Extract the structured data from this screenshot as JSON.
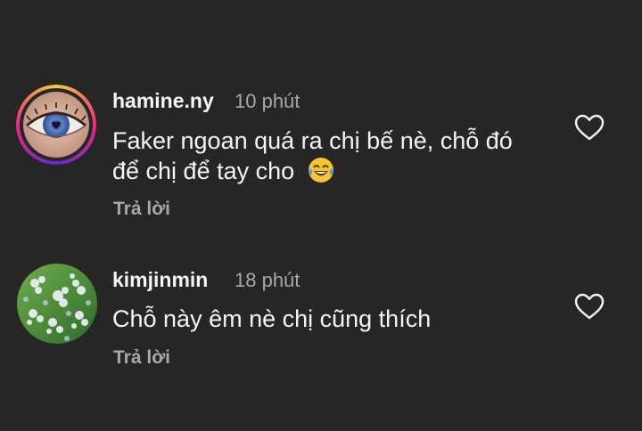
{
  "comments": [
    {
      "username": "hamine.ny",
      "time": "10 phút",
      "line1": "Faker ngoan quá ra chị bế nè, chỗ đó",
      "line2": "để chị để tay cho",
      "emoji": "😂",
      "reply": "Trả lời"
    },
    {
      "username": "kimjinmin",
      "time": "18 phút",
      "line1": "Chỗ này êm nè chị cũng thích",
      "reply": "Trả lời"
    }
  ],
  "colors": {
    "background": "#262626",
    "primary_text": "#f5f5f5",
    "secondary_text": "#a8a8a8"
  },
  "icons": [
    "heart-outline-icon",
    "emoji-laughing-icon"
  ]
}
